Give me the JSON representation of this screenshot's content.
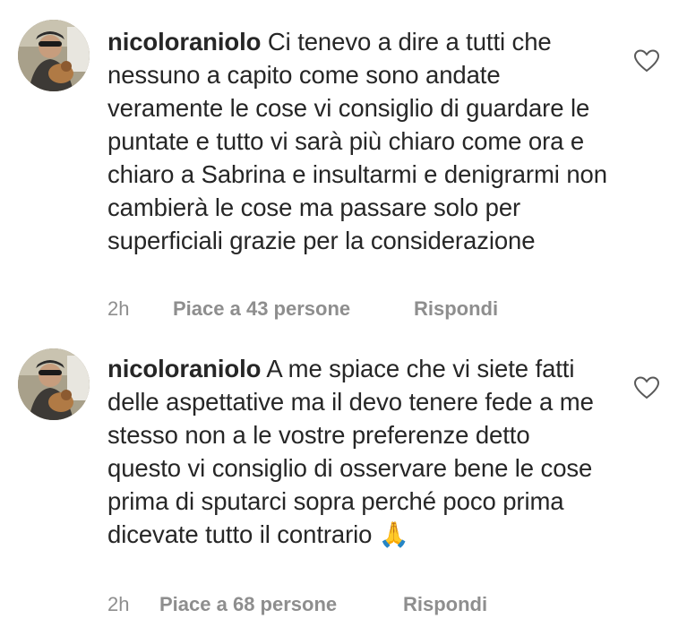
{
  "comments": [
    {
      "username": "nicoloraniolo",
      "text": "Ci tenevo a dire a tutti che nessuno a capito come sono andate veramente le cose vi consiglio di guardare le puntate e tutto vi sarà più chiaro come ora e chiaro a Sabrina e insultarmi e denigrarmi non cambierà le cose ma passare solo per superficiali grazie per la considerazione",
      "time": "2h",
      "likes": "Piace a 43 persone",
      "reply": "Rispondi",
      "avatar_icon": "profile-photo",
      "like_icon": "heart-outline-icon"
    },
    {
      "username": "nicoloraniolo",
      "text": "A me spiace che vi siete fatti delle aspettative ma il devo tenere fede a me stesso non a le vostre preferenze detto questo vi consiglio di osservare bene le cose prima di sputarci sopra perché poco prima dicevate tutto il contrario 🙏",
      "time": "2h",
      "likes": "Piace a 68 persone",
      "reply": "Rispondi",
      "avatar_icon": "profile-photo",
      "like_icon": "heart-outline-icon"
    }
  ],
  "colors": {
    "text": "#262626",
    "secondary": "#8e8e8e",
    "background": "#ffffff"
  }
}
